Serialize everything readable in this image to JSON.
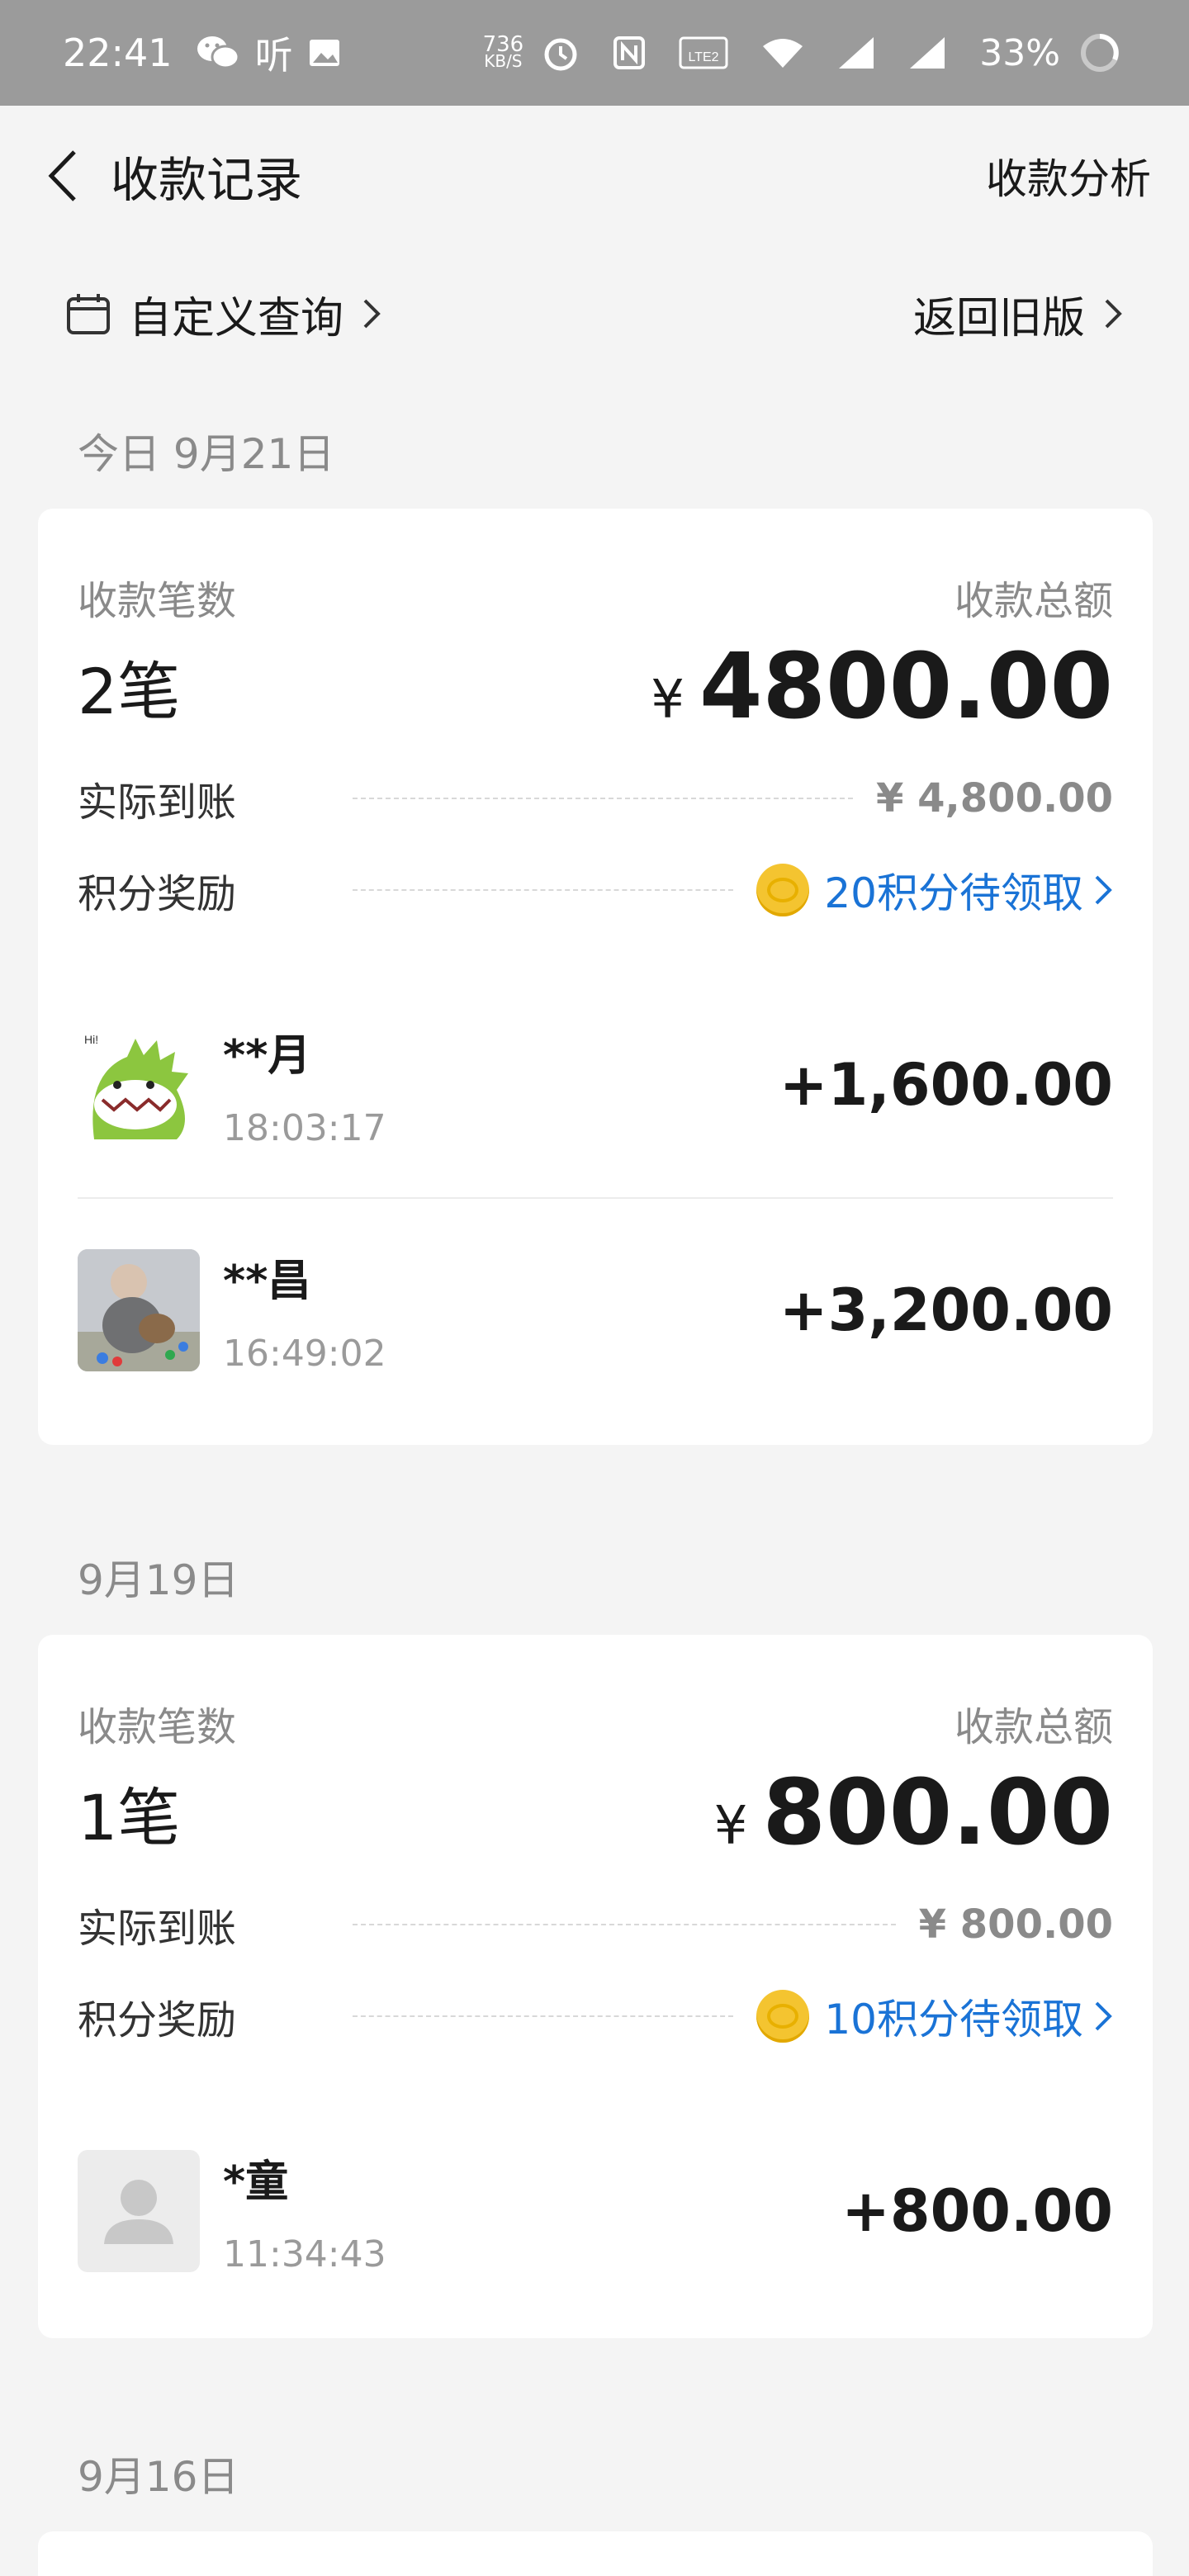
{
  "status_bar": {
    "time": "22:41",
    "left_text": "听",
    "speed_top": "736",
    "speed_bottom": "KB/S",
    "lte": "LTE2",
    "battery": "33%"
  },
  "nav": {
    "title": "收款记录",
    "right": "收款分析"
  },
  "filter": {
    "left_label": "自定义查询",
    "right_label": "返回旧版"
  },
  "labels": {
    "count_label": "收款笔数",
    "total_label": "收款总额",
    "actual_label": "实际到账",
    "reward_label": "积分奖励",
    "yen": "¥"
  },
  "sections": [
    {
      "date": "今日 9月21日",
      "count": "2笔",
      "total": "4800.00",
      "actual": "¥ 4,800.00",
      "reward": "20积分待领取",
      "transactions": [
        {
          "name": "**月",
          "time": "18:03:17",
          "amount": "+1,600.00",
          "avatar": "dinosaur-avatar"
        },
        {
          "name": "**昌",
          "time": "16:49:02",
          "amount": "+3,200.00",
          "avatar": "photo-avatar"
        }
      ]
    },
    {
      "date": "9月19日",
      "count": "1笔",
      "total": "800.00",
      "actual": "¥ 800.00",
      "reward": "10积分待领取",
      "transactions": [
        {
          "name": "*童",
          "time": "11:34:43",
          "amount": "+800.00",
          "avatar": "default-avatar"
        }
      ]
    },
    {
      "date": "9月16日"
    }
  ],
  "colors": {
    "status_bar": "#9b9b9b",
    "background": "#f4f4f4",
    "link_blue": "#1a73d6",
    "coin": "#f4c430"
  }
}
